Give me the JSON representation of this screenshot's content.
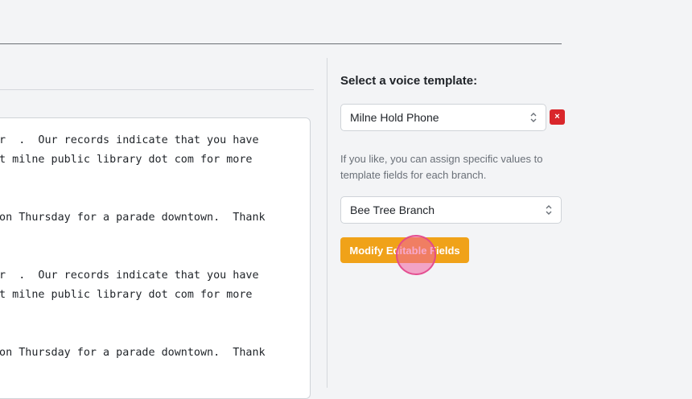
{
  "preview": {
    "lines": [
      "or  .  Our records indicate that you have",
      "ot milne public library dot com for more",
      " on Thursday for a parade downtown.  Thank",
      "or  .  Our records indicate that you have",
      "ot milne public library dot com for more",
      " on Thursday for a parade downtown.  Thank"
    ]
  },
  "template_panel": {
    "heading": "Select a voice template:",
    "template_select": {
      "value": "Milne Hold Phone"
    },
    "remove_label": "×",
    "help_text": "If you like, you can assign specific values to template fields for each branch.",
    "branch_select": {
      "value": "Bee Tree Branch"
    },
    "modify_button": "Modify Editable Fields"
  },
  "colors": {
    "accent": "#f0a219",
    "danger": "#d9262b",
    "cursor": "#f160a0"
  }
}
